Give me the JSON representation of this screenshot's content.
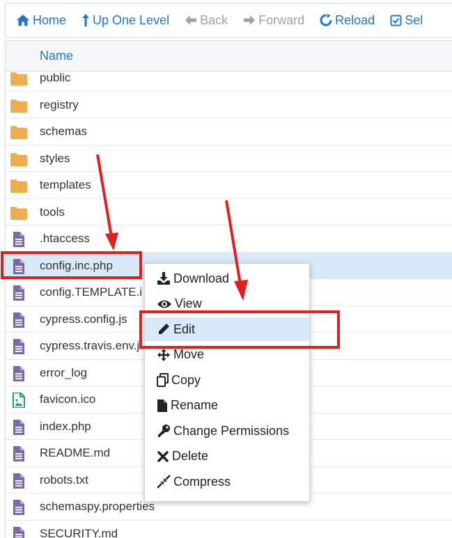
{
  "toolbar": {
    "home": "Home",
    "up_one_level": "Up One Level",
    "back": "Back",
    "forward": "Forward",
    "reload": "Reload",
    "select": "Sel"
  },
  "table": {
    "name_header": "Name",
    "rows": [
      {
        "name": "public",
        "type": "folder"
      },
      {
        "name": "registry",
        "type": "folder"
      },
      {
        "name": "schemas",
        "type": "folder"
      },
      {
        "name": "styles",
        "type": "folder"
      },
      {
        "name": "templates",
        "type": "folder"
      },
      {
        "name": "tools",
        "type": "folder"
      },
      {
        "name": ".htaccess",
        "type": "file"
      },
      {
        "name": "config.inc.php",
        "type": "file",
        "selected": true
      },
      {
        "name": "config.TEMPLATE.i",
        "type": "file"
      },
      {
        "name": "cypress.config.js",
        "type": "file"
      },
      {
        "name": "cypress.travis.env.j",
        "type": "file"
      },
      {
        "name": "error_log",
        "type": "file"
      },
      {
        "name": "favicon.ico",
        "type": "image"
      },
      {
        "name": "index.php",
        "type": "file"
      },
      {
        "name": "README.md",
        "type": "file"
      },
      {
        "name": "robots.txt",
        "type": "file"
      },
      {
        "name": "schemaspy.properties",
        "type": "file"
      },
      {
        "name": "SECURITY.md",
        "type": "file"
      }
    ]
  },
  "context_menu": {
    "items": [
      {
        "label": "Download",
        "icon": "download-icon"
      },
      {
        "label": "View",
        "icon": "eye-icon"
      },
      {
        "label": "Edit",
        "icon": "pencil-icon",
        "highlighted": true
      },
      {
        "label": "Move",
        "icon": "move-icon"
      },
      {
        "label": "Copy",
        "icon": "copy-icon"
      },
      {
        "label": "Rename",
        "icon": "file-icon"
      },
      {
        "label": "Change Permissions",
        "icon": "key-icon"
      },
      {
        "label": "Delete",
        "icon": "close-icon"
      },
      {
        "label": "Compress",
        "icon": "compress-icon"
      }
    ]
  },
  "colors": {
    "link": "#1e78c8",
    "folder": "#f0ad4e",
    "file": "#7c6aa6",
    "image_file": "#1fa07a",
    "selection": "#d8eaf7",
    "annotation": "#e02020"
  }
}
